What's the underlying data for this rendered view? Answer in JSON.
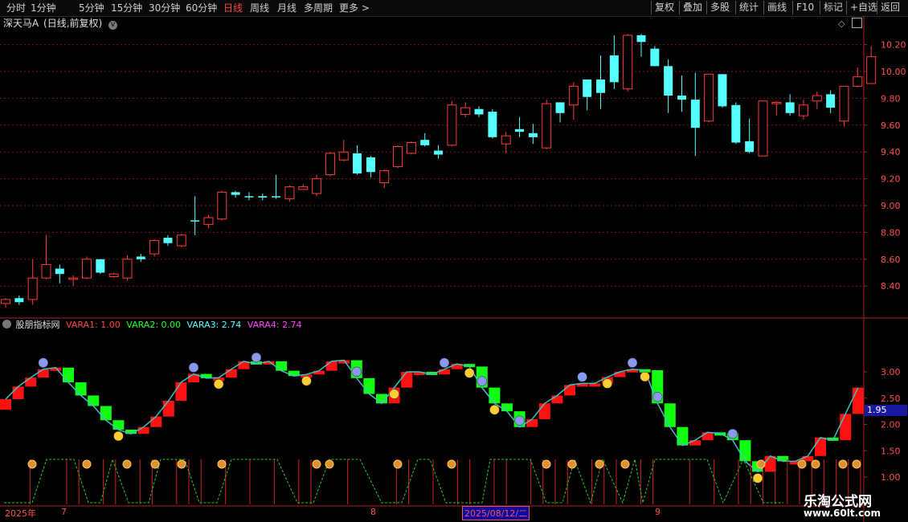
{
  "toolbar": {
    "periods": [
      "分时",
      "1分钟",
      "5分钟",
      "15分钟",
      "30分钟",
      "60分钟",
      "日线",
      "周线",
      "月线",
      "多周期",
      "更多 >"
    ],
    "active": "日线",
    "actions": [
      "复权",
      "叠加",
      "多股",
      "统计",
      "画线",
      "F10",
      "标记",
      "+自选",
      "返回"
    ]
  },
  "main_chart": {
    "title": "深天马A",
    "subtitle": "(日线,前复权)",
    "y_ticks": [
      "10.20",
      "10.00",
      "9.80",
      "9.60",
      "9.40",
      "9.20",
      "9.00",
      "8.80",
      "8.60",
      "8.40"
    ],
    "colors": {
      "up": "#ff3c3c",
      "down": "#54ffff"
    }
  },
  "indicator": {
    "name": "股朋指标网",
    "vars": [
      {
        "label": "VARA1: 1.00",
        "color": "#ff4646"
      },
      {
        "label": "VARA2: 0.00",
        "color": "#22ff22"
      },
      {
        "label": "VARA3: 2.74",
        "color": "#54ffff"
      },
      {
        "label": "VARA4: 2.74",
        "color": "#ff44ff"
      }
    ],
    "y_ticks": [
      "3.00",
      "2.50",
      "2.00",
      "1.50",
      "1.00"
    ],
    "current_value": "1.95"
  },
  "date_axis": {
    "labels": [
      "2025年",
      "7",
      "8",
      "9"
    ],
    "selected": "2025/08/12/二"
  },
  "watermark": {
    "name": "乐淘公式网",
    "url": "www.60lt.com"
  }
}
